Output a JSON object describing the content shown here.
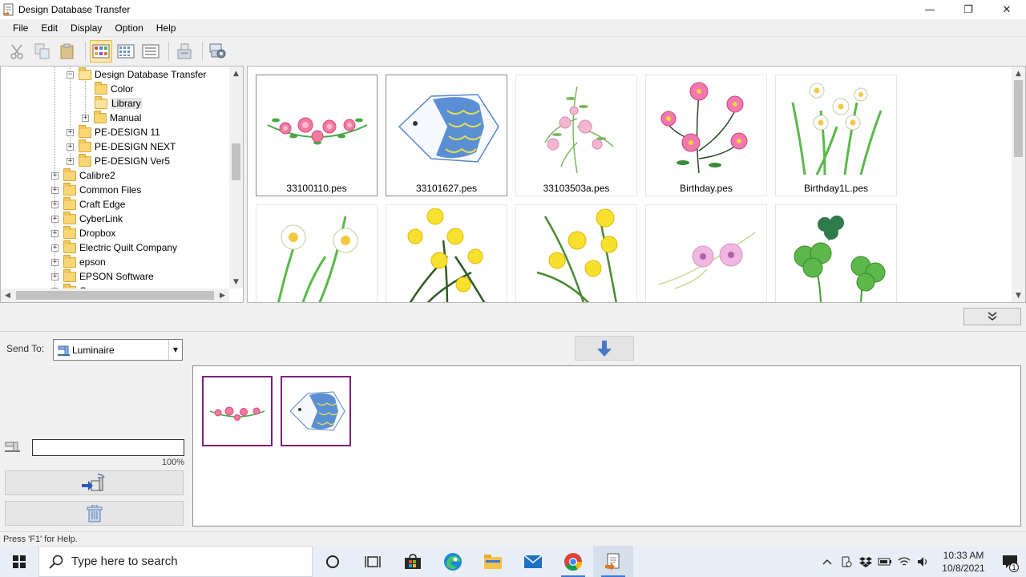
{
  "window": {
    "title": "Design Database Transfer",
    "controls": {
      "minimize": "—",
      "maximize": "❐",
      "close": "✕"
    }
  },
  "menu": [
    "File",
    "Edit",
    "Display",
    "Option",
    "Help"
  ],
  "toolbar": {
    "buttons": [
      "cut-icon",
      "copy-icon",
      "paste-icon",
      "large-thumbnails-icon",
      "small-thumbnails-icon",
      "details-list-icon",
      "write-card-icon",
      "settings-icon"
    ],
    "active": "large-thumbnails-icon"
  },
  "tree": {
    "items": [
      {
        "label": "Design Database Transfer",
        "open": true
      },
      {
        "label": "Color"
      },
      {
        "label": "Library",
        "selected": true
      },
      {
        "label": "Manual"
      },
      {
        "label": "PE-DESIGN 11"
      },
      {
        "label": "PE-DESIGN NEXT"
      },
      {
        "label": "PE-DESIGN Ver5"
      },
      {
        "label": "Calibre2"
      },
      {
        "label": "Common Files"
      },
      {
        "label": "Craft Edge"
      },
      {
        "label": "CyberLink"
      },
      {
        "label": "Dropbox"
      },
      {
        "label": "Electric Quilt Company"
      },
      {
        "label": "epson"
      },
      {
        "label": "EPSON Software"
      },
      {
        "label": "G..."
      }
    ]
  },
  "thumbnails": [
    {
      "name": "33100110.pes",
      "selected": true
    },
    {
      "name": "33101627.pes",
      "selected": true
    },
    {
      "name": "33103503a.pes"
    },
    {
      "name": "Birthday.pes"
    },
    {
      "name": "Birthday1L.pes"
    },
    {
      "name": ""
    },
    {
      "name": ""
    },
    {
      "name": ""
    },
    {
      "name": ""
    },
    {
      "name": ""
    }
  ],
  "transfer": {
    "send_to_label": "Send To:",
    "send_to_value": "Luminaire",
    "progress_percent": 100,
    "progress_label": "100%",
    "queue": [
      "33100110.pes",
      "33101627.pes"
    ]
  },
  "statusbar": {
    "text": "Press 'F1' for Help."
  },
  "taskbar": {
    "search_placeholder": "Type here to search",
    "apps": [
      "cortana-icon",
      "task-view-icon",
      "store-icon",
      "edge-icon",
      "file-explorer-icon",
      "mail-icon",
      "chrome-icon",
      "design-transfer-icon"
    ],
    "time": "10:33 AM",
    "date": "10/8/2021",
    "notification_count": "1"
  }
}
